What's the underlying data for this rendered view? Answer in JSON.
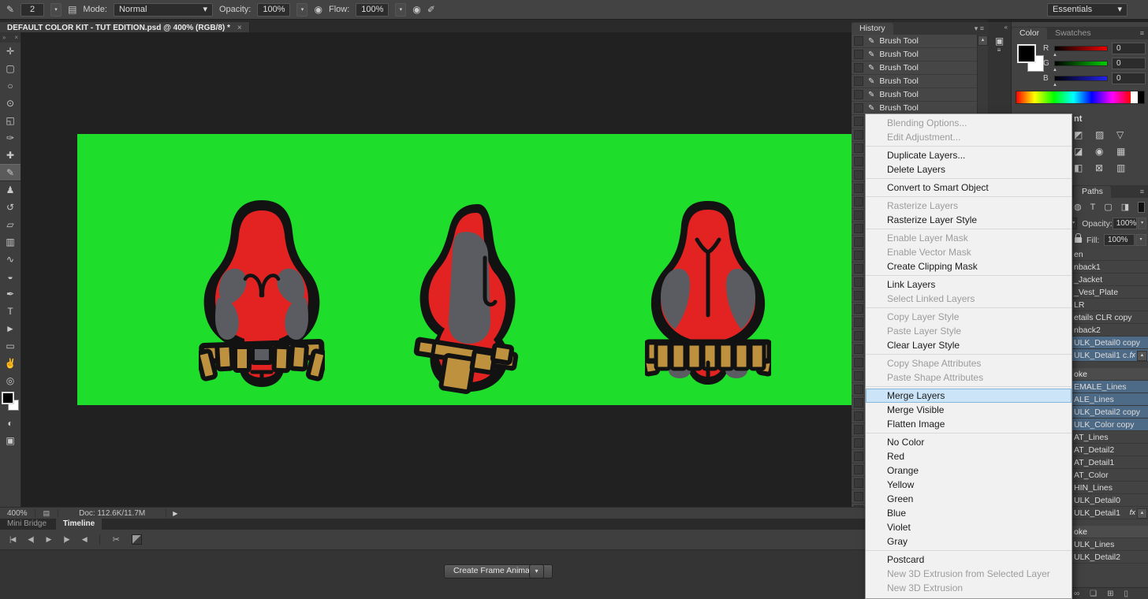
{
  "colors": {
    "ink": "#121212",
    "fig-red": "#e22322",
    "fig-gray": "#5b5c62",
    "belt-tan": "#bd913d",
    "artboard-green": "#1fdd2b",
    "menu-highlight": "#cbe4f7",
    "selected-layer": "#4d6a86"
  },
  "icons": {
    "tool-preset-icon": "✎",
    "brush-preset-icon": "✎",
    "brush-panel-icon": "▤",
    "airbrush-icon": "◉",
    "flow-airbrush-icon": "◉",
    "pressure-icon": "✐",
    "dropdown-arrow": "▾",
    "spinner-arrow": "▾",
    "panel-menu-icon": "≡",
    "panel-dropdown-icon": "▾",
    "tab-close-icon": "×",
    "collapse-left-icon": "«",
    "snapshot-icon": "▣",
    "snapshot-lines-icon": "≡",
    "scroll-up-icon": "▲",
    "history-brush-icon": "✎",
    "doc-status-icon": "▤",
    "status-arrow-icon": "▶",
    "swap-colors-icon": "⇄",
    "transition-icon": ""
  },
  "options_bar": {
    "brush_size": "2",
    "mode_label": "Mode:",
    "mode_value": "Normal",
    "opacity_label": "Opacity:",
    "opacity_value": "100%",
    "flow_label": "Flow:",
    "flow_value": "100%"
  },
  "workspace": {
    "label": "Essentials"
  },
  "document_tab": {
    "title": "DEFAULT COLOR KIT - TUT EDITION.psd @ 400% (RGB/8) *"
  },
  "toolbar": {
    "collapse": "»",
    "close": "×",
    "tools": [
      {
        "name": "move-tool",
        "glyph": "✛"
      },
      {
        "name": "marquee-tool",
        "glyph": "▢"
      },
      {
        "name": "lasso-tool",
        "glyph": "○"
      },
      {
        "name": "quick-select-tool",
        "glyph": "⊙"
      },
      {
        "name": "crop-tool",
        "glyph": "◱"
      },
      {
        "name": "eyedropper-tool",
        "glyph": "✑"
      },
      {
        "name": "healing-brush-tool",
        "glyph": "✚"
      },
      {
        "name": "brush-tool",
        "glyph": "✎",
        "active": true
      },
      {
        "name": "clone-stamp-tool",
        "glyph": "♟"
      },
      {
        "name": "history-brush-tool",
        "glyph": "↺"
      },
      {
        "name": "eraser-tool",
        "glyph": "▱"
      },
      {
        "name": "gradient-tool",
        "glyph": "▥"
      },
      {
        "name": "smudge-tool",
        "glyph": "∿"
      },
      {
        "name": "dodge-tool",
        "glyph": "◒"
      },
      {
        "name": "pen-tool",
        "glyph": "✒"
      },
      {
        "name": "type-tool",
        "glyph": "T"
      },
      {
        "name": "path-select-tool",
        "glyph": "►"
      },
      {
        "name": "shape-tool",
        "glyph": "▭"
      },
      {
        "name": "hand-tool",
        "glyph": "✌"
      },
      {
        "name": "zoom-tool",
        "glyph": "◎"
      }
    ],
    "extra_tools": [
      {
        "name": "quick-mask-tool",
        "glyph": "◐"
      },
      {
        "name": "screen-mode-tool",
        "glyph": "▣"
      }
    ]
  },
  "history": {
    "title": "History",
    "entry_label": "Brush Tool"
  },
  "color_panel": {
    "tabs": [
      "Color",
      "Swatches"
    ],
    "channels": [
      {
        "label": "R",
        "value": "0"
      },
      {
        "label": "G",
        "value": "0"
      },
      {
        "label": "B",
        "value": "0"
      }
    ]
  },
  "adjustments_panel": {
    "header_fragment": "nt",
    "icons": [
      {
        "name": "adjustment-levels-icon",
        "glyph": "◩"
      },
      {
        "name": "adjustment-curves-icon",
        "glyph": "▨"
      },
      {
        "name": "adjustment-exposure-icon",
        "glyph": "▽"
      },
      {
        "name": "adjustment-vibrance-icon",
        "glyph": "◪"
      },
      {
        "name": "adjustment-hue-icon",
        "glyph": "◉"
      },
      {
        "name": "adjustment-balance-icon",
        "glyph": "▦"
      },
      {
        "name": "adjustment-bw-icon",
        "glyph": "◧"
      },
      {
        "name": "adjustment-filter-icon",
        "glyph": "⊠"
      },
      {
        "name": "adjustment-mixer-icon",
        "glyph": "▥"
      }
    ]
  },
  "paths_panel": {
    "title": "Paths"
  },
  "layers_panel": {
    "filter_icons": [
      {
        "name": "filter-pixel-icon",
        "glyph": "◍"
      },
      {
        "name": "filter-type-icon",
        "glyph": "T"
      },
      {
        "name": "filter-shape-icon",
        "glyph": "▢"
      },
      {
        "name": "filter-smart-icon",
        "glyph": "◨"
      }
    ],
    "opacity_label": "Opacity:",
    "opacity_value": "100%",
    "fill_label": "Fill:",
    "fill_value": "100%",
    "fx_label": "fx",
    "rows": [
      {
        "label": "en"
      },
      {
        "label": "nback1"
      },
      {
        "label": "_Jacket"
      },
      {
        "label": "_Vest_Plate"
      },
      {
        "label": "LR"
      },
      {
        "label": "etails CLR copy"
      },
      {
        "label": "nback2"
      },
      {
        "label": "ULK_Detail0 copy",
        "selected": true
      },
      {
        "label": "ULK_Detail1 c...",
        "selected": true,
        "fx": true
      },
      {
        "label": "oke",
        "group": true
      },
      {
        "label": "EMALE_Lines",
        "selected": true
      },
      {
        "label": "ALE_Lines",
        "selected": true
      },
      {
        "label": "ULK_Detail2 copy",
        "selected": true
      },
      {
        "label": "ULK_Color copy",
        "selected": true
      },
      {
        "label": "AT_Lines"
      },
      {
        "label": "AT_Detail2"
      },
      {
        "label": "AT_Detail1"
      },
      {
        "label": "AT_Color"
      },
      {
        "label": "HIN_Lines"
      },
      {
        "label": "ULK_Detail0"
      },
      {
        "label": "ULK_Detail1",
        "fx": true
      },
      {
        "label": "oke",
        "group": true
      },
      {
        "label": "ULK_Lines"
      },
      {
        "label": "ULK_Detail2"
      }
    ],
    "bottom_icons": [
      {
        "name": "link-layers-icon",
        "glyph": "∞"
      },
      {
        "name": "new-group-icon",
        "glyph": "❏"
      },
      {
        "name": "new-layer-icon",
        "glyph": "⊞"
      },
      {
        "name": "delete-layer-icon",
        "glyph": "▯"
      }
    ]
  },
  "context_menu": {
    "groups": [
      [
        {
          "label": "Blending Options...",
          "disabled": true
        },
        {
          "label": "Edit Adjustment...",
          "disabled": true
        }
      ],
      [
        {
          "label": "Duplicate Layers..."
        },
        {
          "label": "Delete Layers"
        }
      ],
      [
        {
          "label": "Convert to Smart Object"
        }
      ],
      [
        {
          "label": "Rasterize Layers",
          "disabled": true
        },
        {
          "label": "Rasterize Layer Style"
        }
      ],
      [
        {
          "label": "Enable Layer Mask",
          "disabled": true
        },
        {
          "label": "Enable Vector Mask",
          "disabled": true
        },
        {
          "label": "Create Clipping Mask"
        }
      ],
      [
        {
          "label": "Link Layers"
        },
        {
          "label": "Select Linked Layers",
          "disabled": true
        }
      ],
      [
        {
          "label": "Copy Layer Style",
          "disabled": true
        },
        {
          "label": "Paste Layer Style",
          "disabled": true
        },
        {
          "label": "Clear Layer Style"
        }
      ],
      [
        {
          "label": "Copy Shape Attributes",
          "disabled": true
        },
        {
          "label": "Paste Shape Attributes",
          "disabled": true
        }
      ],
      [
        {
          "label": "Merge Layers",
          "highlighted": true
        },
        {
          "label": "Merge Visible"
        },
        {
          "label": "Flatten Image"
        }
      ],
      [
        {
          "label": "No Color"
        },
        {
          "label": "Red"
        },
        {
          "label": "Orange"
        },
        {
          "label": "Yellow"
        },
        {
          "label": "Green"
        },
        {
          "label": "Blue"
        },
        {
          "label": "Violet"
        },
        {
          "label": "Gray"
        }
      ],
      [
        {
          "label": "Postcard"
        },
        {
          "label": "New 3D Extrusion from Selected Layer",
          "disabled": true
        },
        {
          "label": "New 3D Extrusion",
          "disabled": true
        }
      ]
    ]
  },
  "status_bar": {
    "zoom": "400%",
    "doc_info": "Doc: 112.6K/11.7M"
  },
  "timeline": {
    "tabs": [
      {
        "label": "Mini Bridge",
        "active": false
      },
      {
        "label": "Timeline",
        "active": true
      }
    ],
    "transport": [
      {
        "name": "go-first-frame-icon",
        "glyph": "|◀"
      },
      {
        "name": "prev-frame-icon",
        "glyph": "◀|"
      },
      {
        "name": "play-icon",
        "glyph": "▶"
      },
      {
        "name": "next-frame-icon",
        "glyph": "|▶"
      },
      {
        "name": "audio-mute-icon",
        "glyph": "◀"
      },
      {
        "name": "scissors-icon",
        "glyph": "✂",
        "sep": true
      }
    ],
    "create_button": "Create Frame Animation"
  }
}
